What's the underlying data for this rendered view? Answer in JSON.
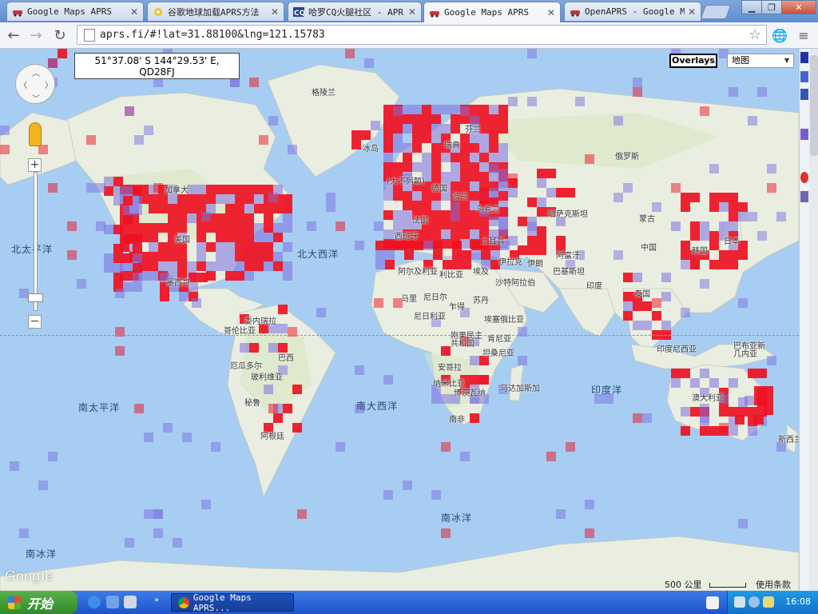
{
  "browser": {
    "tabs": [
      {
        "label": "Google Maps APRS",
        "icon": "car-icon",
        "active": false
      },
      {
        "label": "谷歌地球加载APRS方法",
        "icon": "folder-icon",
        "active": false
      },
      {
        "label": "哈罗CQ火腿社区 - APR",
        "icon": "cq-icon",
        "active": false
      },
      {
        "label": "Google Maps APRS",
        "icon": "car-icon",
        "active": true
      },
      {
        "label": "OpenAPRS - Google Ma",
        "icon": "car-icon",
        "active": false
      }
    ],
    "url": "aprs.fi/#!lat=31.88100&lng=121.15783",
    "window_buttons": [
      "minimize",
      "restore",
      "close"
    ]
  },
  "map": {
    "coord_box": {
      "line1": "51°37.08' S 144°29.53' E,",
      "line2": "QD28FJ"
    },
    "overlays_label": "Overlays",
    "map_type": "地图",
    "logo": "Google",
    "scale_label": "500 公里",
    "terms_label": "使用条款",
    "labels": {
      "greenland": "格陵兰",
      "iceland": "冰岛",
      "finland": "芬兰",
      "sweden": "瑞典",
      "uk": "(大不列颠)",
      "germany": "德国",
      "poland": "波兰",
      "ukraine": "乌克兰",
      "france": "法国",
      "spain": "西班牙",
      "turkey": "土耳其",
      "russia": "俄罗斯",
      "kazakhstan": "哈萨克斯坦",
      "mongolia": "蒙古",
      "china": "中国",
      "japan": "日本",
      "korea": "韩国",
      "iraq": "伊拉克",
      "iran": "伊朗",
      "afghanistan": "阿富汗",
      "pakistan": "巴基斯坦",
      "india": "印度",
      "thailand": "泰国",
      "indonesia": "印度尼西亚",
      "png": "巴布亚新\n几内亚",
      "australia": "澳大利亚",
      "new_zealand": "新西兰",
      "canada": "加拿大",
      "usa": "美国",
      "mexico": "墨西哥",
      "venezuela": "委内瑞拉",
      "colombia": "哥伦比亚",
      "ecuador": "厄瓜多尔",
      "brazil": "巴西",
      "peru": "秘鲁",
      "bolivia": "玻利维亚",
      "argentina": "阿根廷",
      "algeria": "阿尔及利亚",
      "libya": "利比亚",
      "egypt": "埃及",
      "saudi": "沙特阿拉伯",
      "mali": "马里",
      "niger": "尼日尔",
      "chad": "乍得",
      "sudan": "苏丹",
      "nigeria": "尼日利亚",
      "ethiopia": "埃塞俄比亚",
      "drc": "刚果民主\n共和国",
      "kenya": "肯尼亚",
      "tanzania": "坦桑尼亚",
      "angola": "安哥拉",
      "namibia": "纳米比亚",
      "botswana": "博茨瓦纳",
      "madagascar": "马达加斯加",
      "south_africa": "南非"
    },
    "oceans": {
      "north_pacific": "北太平洋",
      "north_atlantic": "北大西洋",
      "south_pacific": "南太平洋",
      "south_atlantic": "南大西洋",
      "indian_ocean": "印度洋",
      "southern_ocean": "南冰洋",
      "southern_ocean_left": "南冰洋"
    }
  },
  "taskbar": {
    "start_label": "开始",
    "task_item": "Google Maps APRS...",
    "clock": "16:08"
  }
}
